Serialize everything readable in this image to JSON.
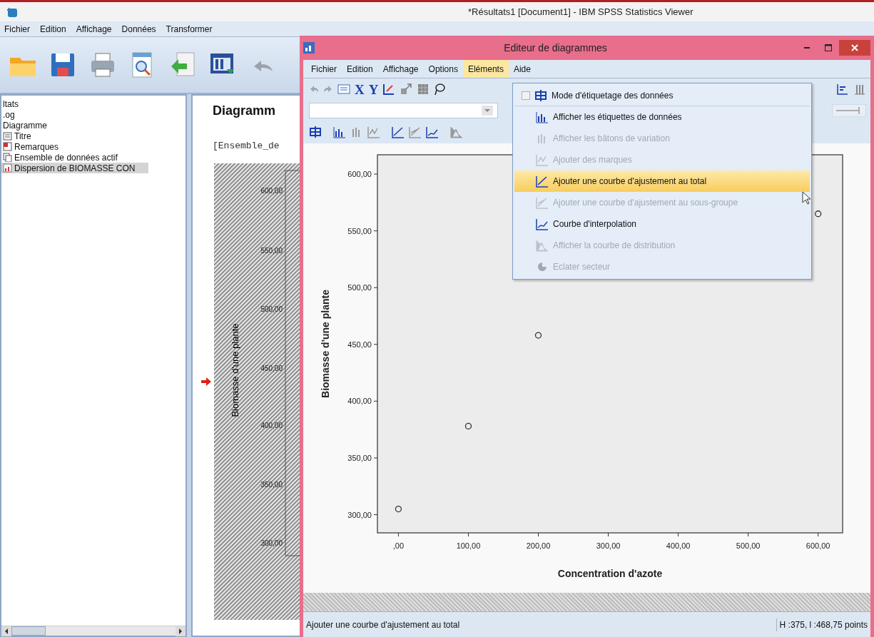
{
  "window": {
    "title": "*Résultats1 [Document1] - IBM SPSS Statistics Viewer"
  },
  "menu": [
    {
      "label": "Fichier"
    },
    {
      "label": "Edition"
    },
    {
      "label": "Affichage"
    },
    {
      "label": "Données"
    },
    {
      "label": "Transformer"
    }
  ],
  "outline": [
    {
      "label": "ltats",
      "kind": "text",
      "selected": false
    },
    {
      "label": ".og",
      "kind": "text",
      "selected": false
    },
    {
      "label": "Diagramme",
      "kind": "text",
      "selected": false
    },
    {
      "label": "Titre",
      "kind": "node",
      "selected": false
    },
    {
      "label": "Remarques",
      "kind": "node",
      "selected": false
    },
    {
      "label": "Ensemble de données actif",
      "kind": "node",
      "selected": false
    },
    {
      "label": "Dispersion de BIOMASSE CON",
      "kind": "node",
      "selected": true
    }
  ],
  "viewer": {
    "heading": "Diagramm",
    "dataset": "[Ensemble_de",
    "chart_preview": {
      "ylabel": "Biomasse d'une plante",
      "tick_labels": [
        "600,00",
        "550,00",
        "500,00",
        "450,00",
        "400,00",
        "350,00",
        "300,00"
      ]
    }
  },
  "editor": {
    "title": "Editeur de diagrammes",
    "menu": [
      {
        "label": "Fichier",
        "selected": false
      },
      {
        "label": "Edition",
        "selected": false
      },
      {
        "label": "Affichage",
        "selected": false
      },
      {
        "label": "Options",
        "selected": false
      },
      {
        "label": "Eléments",
        "selected": true
      },
      {
        "label": "Aide",
        "selected": false
      }
    ],
    "toolbar_letters": [
      "X",
      "Y"
    ],
    "dropdown": [
      {
        "label": "Mode d'étiquetage des données",
        "kind": "check",
        "checked": false,
        "disabled": false,
        "selected": false
      },
      {
        "label": "Afficher les étiquettes de données",
        "kind": "item",
        "disabled": false,
        "selected": false
      },
      {
        "label": "Afficher les bâtons de variation",
        "kind": "item",
        "disabled": true,
        "selected": false
      },
      {
        "label": "Ajouter des marques",
        "kind": "item",
        "disabled": true,
        "selected": false
      },
      {
        "label": "Ajouter une courbe d'ajustement au total",
        "kind": "item",
        "disabled": false,
        "selected": true
      },
      {
        "label": "Ajouter une courbe d'ajustement au sous-groupe",
        "kind": "item",
        "disabled": true,
        "selected": false
      },
      {
        "label": "Courbe d'interpolation",
        "kind": "item",
        "disabled": false,
        "selected": false
      },
      {
        "label": "Afficher la courbe de distribution",
        "kind": "item",
        "disabled": true,
        "selected": false
      },
      {
        "label": "Eclater secteur",
        "kind": "item",
        "disabled": true,
        "selected": false
      }
    ],
    "chart_data": {
      "type": "scatter",
      "xlabel": "Concentration d'azote",
      "ylabel": "Biomasse d'une plante",
      "x": [
        0,
        100,
        200,
        600
      ],
      "values": [
        305,
        378,
        458,
        565
      ],
      "xlim": [
        -30,
        635
      ],
      "ylim": [
        284,
        617
      ],
      "xticks": [
        {
          "value": 0,
          "label": ",00"
        },
        {
          "value": 100,
          "label": "100,00"
        },
        {
          "value": 200,
          "label": "200,00"
        },
        {
          "value": 300,
          "label": "300,00"
        },
        {
          "value": 400,
          "label": "400,00"
        },
        {
          "value": 500,
          "label": "500,00"
        },
        {
          "value": 600,
          "label": "600,00"
        }
      ],
      "yticks": [
        {
          "value": 300,
          "label": "300,00"
        },
        {
          "value": 350,
          "label": "350,00"
        },
        {
          "value": 400,
          "label": "400,00"
        },
        {
          "value": 450,
          "label": "450,00"
        },
        {
          "value": 500,
          "label": "500,00"
        },
        {
          "value": 550,
          "label": "550,00"
        },
        {
          "value": 600,
          "label": "600,00"
        }
      ]
    },
    "status": "Ajouter une courbe d'ajustement au total",
    "status_size": "H :375, l :468,75 points"
  }
}
